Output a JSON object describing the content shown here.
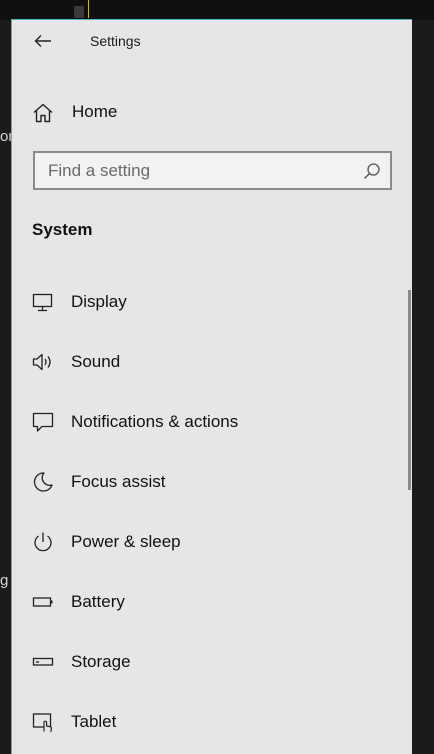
{
  "background": {
    "fragments": [
      "on",
      "g"
    ]
  },
  "window": {
    "title": "Settings",
    "border_color": "#4fb0c6",
    "back_icon": "arrow-left-icon"
  },
  "home": {
    "label": "Home",
    "icon": "home-icon"
  },
  "search": {
    "placeholder": "Find a setting",
    "value": "",
    "icon": "search-icon"
  },
  "section": {
    "title": "System"
  },
  "nav": {
    "items": [
      {
        "label": "Display",
        "icon": "display-icon"
      },
      {
        "label": "Sound",
        "icon": "sound-icon"
      },
      {
        "label": "Notifications & actions",
        "icon": "notifications-icon"
      },
      {
        "label": "Focus assist",
        "icon": "moon-icon"
      },
      {
        "label": "Power & sleep",
        "icon": "power-icon"
      },
      {
        "label": "Battery",
        "icon": "battery-icon"
      },
      {
        "label": "Storage",
        "icon": "storage-icon"
      },
      {
        "label": "Tablet",
        "icon": "tablet-icon"
      }
    ]
  }
}
